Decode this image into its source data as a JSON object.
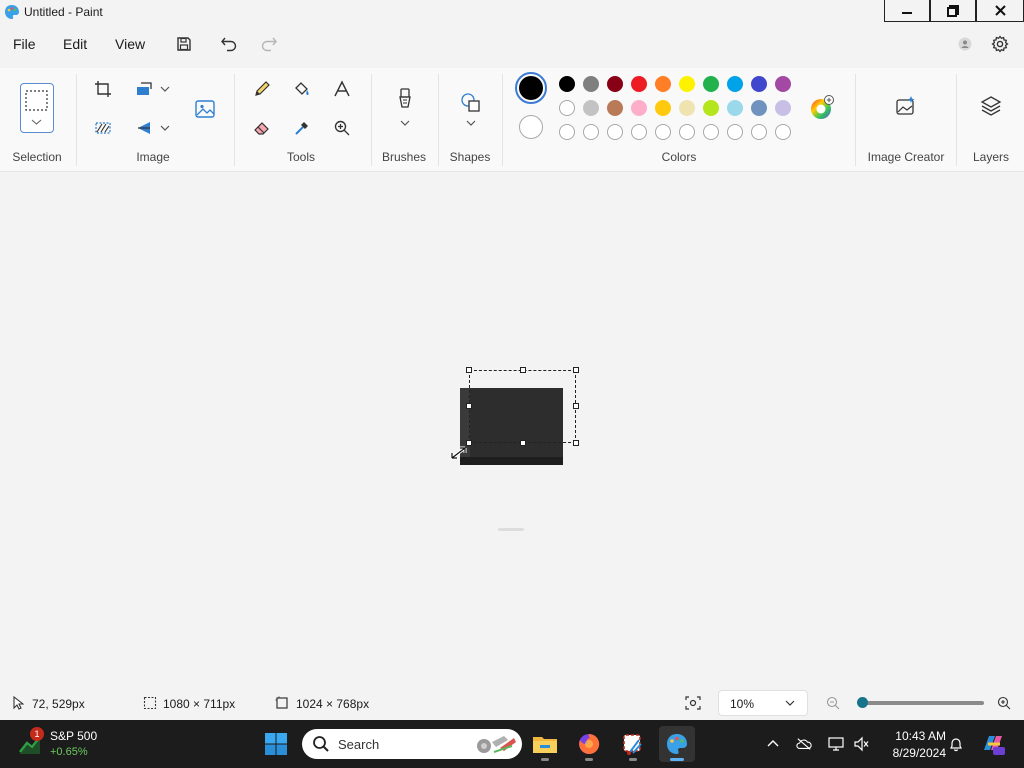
{
  "window": {
    "title": "Untitled - Paint"
  },
  "menu": {
    "file": "File",
    "edit": "Edit",
    "view": "View"
  },
  "ribbon": {
    "groups": {
      "selection": "Selection",
      "image": "Image",
      "tools": "Tools",
      "brushes": "Brushes",
      "shapes": "Shapes",
      "colors": "Colors",
      "image_creator": "Image Creator",
      "layers": "Layers"
    },
    "colors": {
      "primary": "#000000",
      "secondary": "#ffffff",
      "palette_row1": [
        "#000000",
        "#7f7f7f",
        "#880015",
        "#ed1c24",
        "#ff7f27",
        "#fff200",
        "#22b14c",
        "#00a2e8",
        "#3f48cc",
        "#a349a4"
      ],
      "palette_row2": [
        "#ffffff",
        "#c3c3c3",
        "#b97a57",
        "#ffaec9",
        "#ffc90e",
        "#efe4b0",
        "#b5e61d",
        "#99d9ea",
        "#7092be",
        "#c8bfe7"
      ]
    }
  },
  "status": {
    "cursor_position": "72, 529px",
    "selection_size": "1080 × 711px",
    "canvas_size": "1024 × 768px",
    "zoom": "10%",
    "zoom_fraction": 0.0
  },
  "taskbar": {
    "stock_name": "S&P 500",
    "stock_change": "+0.65%",
    "stock_badge": "1",
    "search_label": "Search",
    "time": "10:43 AM",
    "date": "8/29/2024",
    "accent": "#5fb2f2"
  }
}
